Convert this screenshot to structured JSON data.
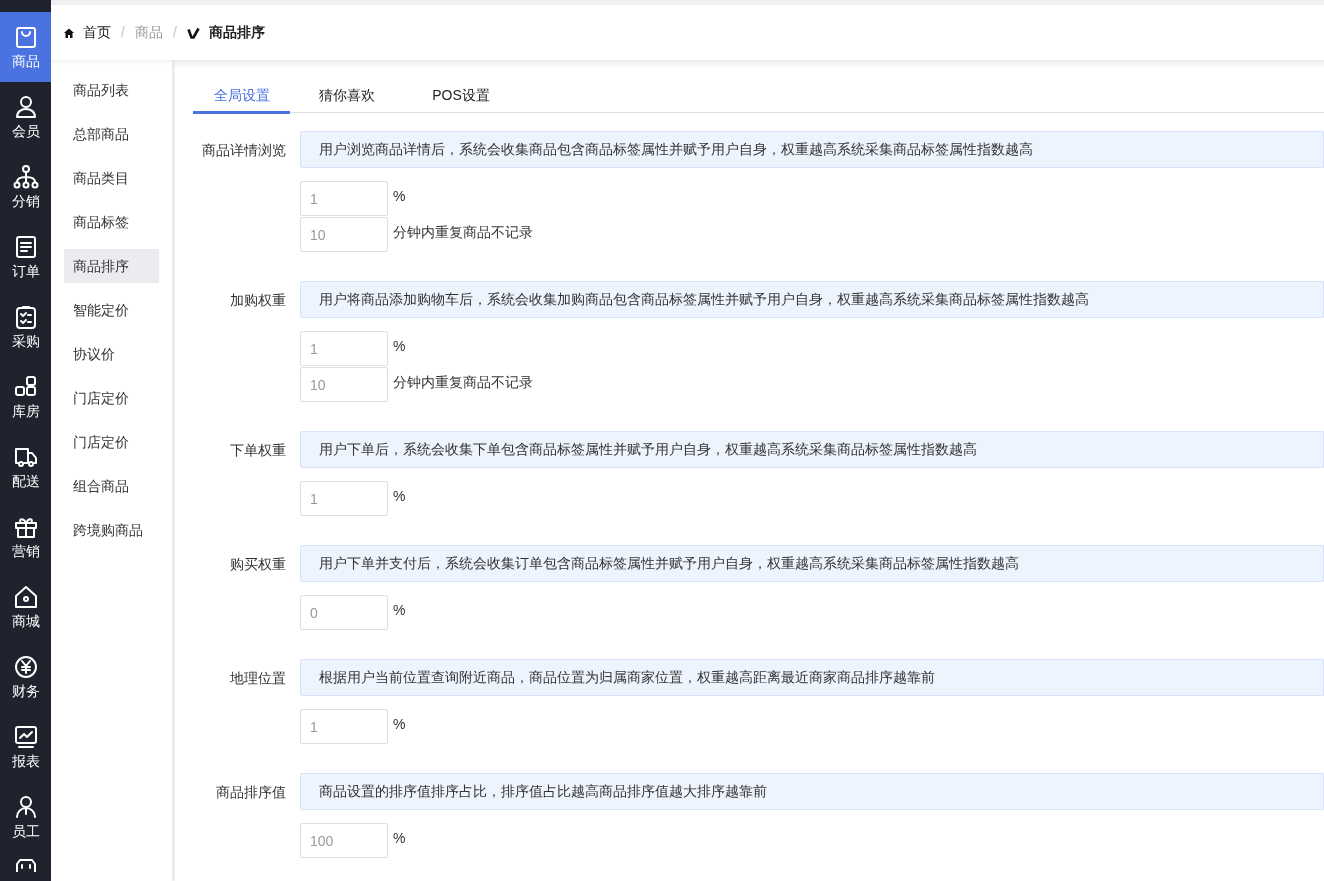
{
  "rail": [
    {
      "label": "商品",
      "selected": true
    },
    {
      "label": "会员",
      "selected": false
    },
    {
      "label": "分销",
      "selected": false
    },
    {
      "label": "订单",
      "selected": false
    },
    {
      "label": "采购",
      "selected": false
    },
    {
      "label": "库房",
      "selected": false
    },
    {
      "label": "配送",
      "selected": false
    },
    {
      "label": "营销",
      "selected": false
    },
    {
      "label": "商城",
      "selected": false
    },
    {
      "label": "财务",
      "selected": false
    },
    {
      "label": "报表",
      "selected": false
    },
    {
      "label": "员工",
      "selected": false
    }
  ],
  "breadcrumb": [
    {
      "label": "首页",
      "kind": "home"
    },
    {
      "label": "商品",
      "kind": "muted",
      "separator": "/"
    },
    {
      "label": "商品排序",
      "kind": "current",
      "separator": "/"
    }
  ],
  "subnav": [
    {
      "label": "商品列表",
      "selected": false
    },
    {
      "label": "总部商品",
      "selected": false
    },
    {
      "label": "商品类目",
      "selected": false
    },
    {
      "label": "商品标签",
      "selected": false
    },
    {
      "label": "商品排序",
      "selected": true
    },
    {
      "label": "智能定价",
      "selected": false
    },
    {
      "label": "协议价",
      "selected": false
    },
    {
      "label": "门店定价",
      "selected": false
    },
    {
      "label": "门店定价",
      "selected": false
    },
    {
      "label": "组合商品",
      "selected": false
    },
    {
      "label": "跨境购商品",
      "selected": false
    }
  ],
  "tabs": [
    {
      "label": "全局设置",
      "selected": true
    },
    {
      "label": "猜你喜欢",
      "selected": false
    },
    {
      "label": "POS设置",
      "selected": false
    }
  ],
  "sections": [
    {
      "label": "商品详情浏览",
      "description": "用户浏览商品详情后，系统会收集商品包含商品标签属性并赋予用户自身，权重越高系统采集商品标签属性指数越高",
      "fields": [
        {
          "value": "1",
          "unit": "%"
        },
        {
          "value": "10",
          "unit": "分钟内重复商品不记录"
        }
      ]
    },
    {
      "label": "加购权重",
      "description": "用户将商品添加购物车后，系统会收集加购商品包含商品标签属性并赋予用户自身，权重越高系统采集商品标签属性指数越高",
      "fields": [
        {
          "value": "1",
          "unit": "%"
        },
        {
          "value": "10",
          "unit": "分钟内重复商品不记录"
        }
      ]
    },
    {
      "label": "下单权重",
      "description": "用户下单后，系统会收集下单包含商品标签属性并赋予用户自身，权重越高系统采集商品标签属性指数越高",
      "fields": [
        {
          "value": "1",
          "unit": "%"
        }
      ]
    },
    {
      "label": "购买权重",
      "description": "用户下单并支付后，系统会收集订单包含商品标签属性并赋予用户自身，权重越高系统采集商品标签属性指数越高",
      "fields": [
        {
          "value": "0",
          "unit": "%"
        }
      ]
    },
    {
      "label": "地理位置",
      "description": "根据用户当前位置查询附近商品，商品位置为归属商家位置，权重越高距离最近商家商品排序越靠前",
      "fields": [
        {
          "value": "1",
          "unit": "%"
        }
      ]
    },
    {
      "label": "商品排序值",
      "description": "商品设置的排序值排序占比，排序值占比越高商品排序值越大排序越靠前",
      "fields": [
        {
          "value": "100",
          "unit": "%"
        }
      ]
    }
  ],
  "more_below": true
}
